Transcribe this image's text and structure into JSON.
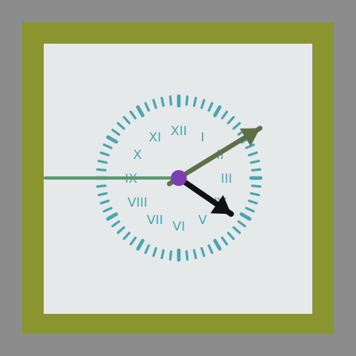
{
  "clock": {
    "numerals": [
      "I",
      "II",
      "III",
      "IV",
      "V",
      "VI",
      "VII",
      "VIII",
      "IX",
      "X",
      "XI",
      "XII"
    ],
    "time_shown": {
      "hour": 4,
      "minute": 9,
      "second": 45
    },
    "colors": {
      "background": "#8c8c8c",
      "frame": "#8a952f",
      "dial": "#e6e9ea",
      "ticks_and_numerals": "#4aa6ae",
      "hour_hand": "#111111",
      "minute_hand": "#5f6f47",
      "second_hand": "#5a9a6e",
      "center_cap": "#7a3fb0"
    }
  }
}
